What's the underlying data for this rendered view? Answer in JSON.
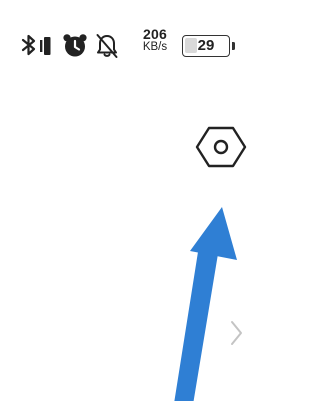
{
  "status_bar": {
    "icons": [
      "bluetooth-icon",
      "vibrate-icon",
      "alarm-icon",
      "notifications-off-icon"
    ],
    "network_speed": {
      "value": "206",
      "unit": "KB/s"
    },
    "battery": {
      "level": "29",
      "fill_fraction": 0.29
    }
  },
  "actions": {
    "settings_icon": "hexagon-settings-icon",
    "chevron_icon": "chevron-right-icon"
  },
  "annotation": {
    "arrow_icon": "pointer-arrow-icon",
    "arrow_color": "#2f7fd4"
  },
  "colors": {
    "background": "#ffffff",
    "icon": "#222222",
    "chevron": "#c4c4c4"
  }
}
